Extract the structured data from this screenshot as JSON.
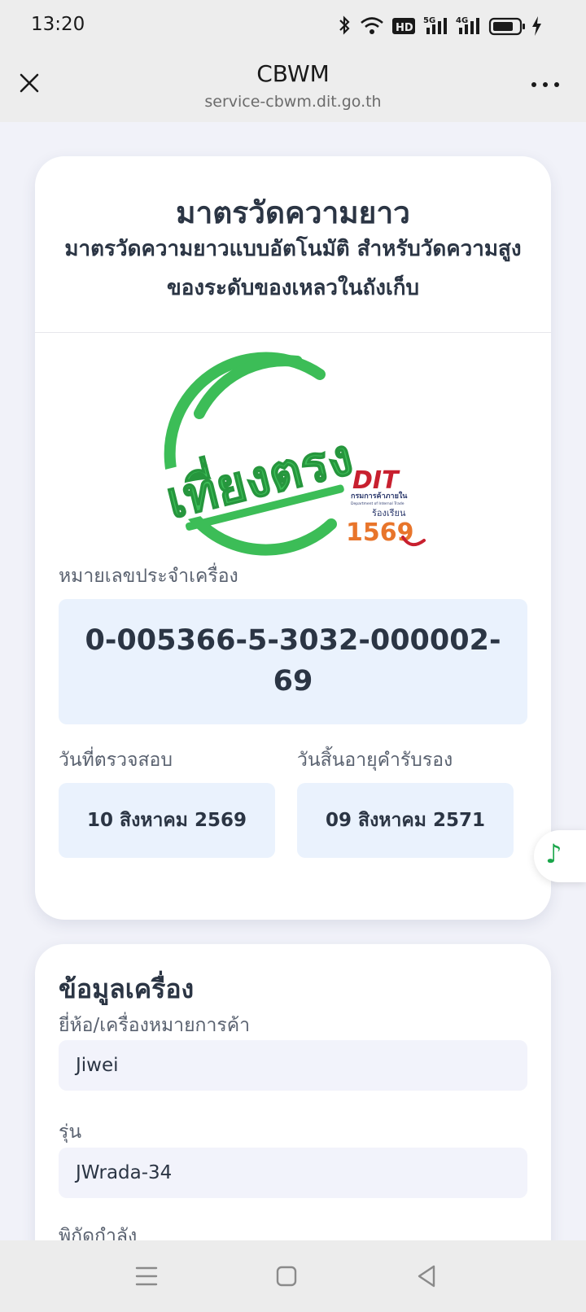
{
  "status_bar": {
    "time": "13:20",
    "icons": [
      "bluetooth-icon",
      "wifi-icon",
      "hd-icon",
      "5g-signal-icon",
      "4g-signal-icon",
      "battery-icon",
      "charging-icon"
    ],
    "hd_label": "HD",
    "net1_label": "5G",
    "net2_label": "4G"
  },
  "browser": {
    "title": "CBWM",
    "url": "service-cbwm.dit.go.th"
  },
  "card_main": {
    "title": "มาตรวัดความยาว",
    "subtitle": "มาตรวัดความยาวแบบอัตโนมัติ สำหรับวัดความสูงของระดับของเหลวในถังเก็บ",
    "stamp_text": "เที่ยงตรง",
    "logo": {
      "brand": "DIT",
      "org_th": "กรมการค้าภายใน",
      "org_en": "Department of Internal Trade",
      "complaint": "ร้องเรียน",
      "hotline": "1569"
    },
    "serial_label": "หมายเลขประจำเครื่อง",
    "serial_value": "0-005366-5-3032-000002-69",
    "inspect_label": "วันที่ตรวจสอบ",
    "inspect_date": "10 สิงหาคม 2569",
    "expiry_label": "วันสิ้นอายุคำรับรอง",
    "expiry_date": "09 สิงหาคม 2571"
  },
  "card_info": {
    "heading": "ข้อมูลเครื่อง",
    "brand_label": "ยี่ห้อ/เครื่องหมายการค้า",
    "brand_value": "Jiwei",
    "model_label": "รุ่น",
    "model_value": "JWrada-34",
    "capacity_label": "พิกัดกำลัง"
  },
  "colors": {
    "accent_green": "#3cbd57",
    "dit_red": "#c8202f",
    "dit_navy": "#2e3b6e",
    "hotline_orange": "#e8752b",
    "box_blue": "#eaf2fd"
  }
}
